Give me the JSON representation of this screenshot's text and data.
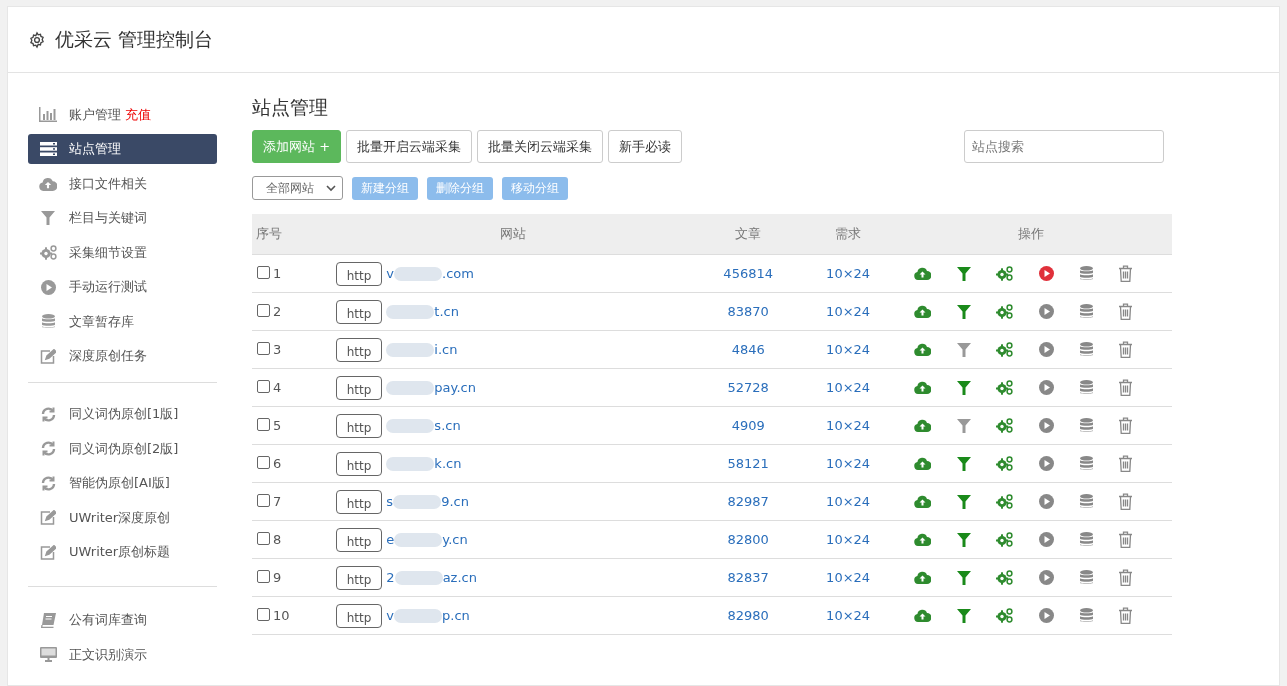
{
  "header": {
    "title": "优采云 管理控制台"
  },
  "sidebar": {
    "groups": [
      {
        "items": [
          {
            "label": "账户管理",
            "link": "充值",
            "selected": false
          },
          {
            "label": "站点管理",
            "selected": true
          },
          {
            "label": "接口文件相关",
            "selected": false
          },
          {
            "label": "栏目与关键词",
            "selected": false
          },
          {
            "label": "采集细节设置",
            "selected": false
          },
          {
            "label": "手动运行测试",
            "selected": false
          },
          {
            "label": "文章暂存库",
            "selected": false
          },
          {
            "label": "深度原创任务",
            "selected": false
          }
        ]
      },
      {
        "items": [
          {
            "label": "同义词伪原创[1版]",
            "selected": false
          },
          {
            "label": "同义词伪原创[2版]",
            "selected": false
          },
          {
            "label": "智能伪原创[AI版]",
            "selected": false
          },
          {
            "label": "UWriter深度原创",
            "selected": false
          },
          {
            "label": "UWriter原创标题",
            "selected": false
          }
        ]
      },
      {
        "items": [
          {
            "label": "公有词库查询",
            "selected": false
          },
          {
            "label": "正文识别演示",
            "selected": false
          }
        ]
      }
    ]
  },
  "main": {
    "title": "站点管理",
    "buttons": [
      {
        "label": "添加网站 +",
        "kind": "primary"
      },
      {
        "label": "批量开启云端采集",
        "kind": "default"
      },
      {
        "label": "批量关闭云端采集",
        "kind": "default"
      },
      {
        "label": "新手必读",
        "kind": "default"
      }
    ],
    "search": {
      "placeholder": "站点搜索"
    },
    "group_select": {
      "value": "全部网站"
    },
    "group_buttons": [
      "新建分组",
      "删除分组",
      "移动分组"
    ],
    "table": {
      "columns": [
        "序号",
        "网站",
        "文章",
        "需求",
        "操作"
      ],
      "rows": [
        {
          "index": "1",
          "checked": false,
          "protocol": "http",
          "site_prefix": "v",
          "site_suffix": ".com",
          "articles": "456814",
          "demand": "10×24",
          "filter_on": true,
          "running": true
        },
        {
          "index": "2",
          "checked": false,
          "protocol": "http",
          "site_suffix": "t.cn",
          "articles": "83870",
          "demand": "10×24",
          "filter_on": true,
          "running": false
        },
        {
          "index": "3",
          "checked": false,
          "protocol": "http",
          "site_suffix": "i.cn",
          "articles": "4846",
          "demand": "10×24",
          "filter_on": false,
          "running": false
        },
        {
          "index": "4",
          "checked": false,
          "protocol": "http",
          "site_suffix": "pay.cn",
          "articles": "52728",
          "demand": "10×24",
          "filter_on": true,
          "running": false
        },
        {
          "index": "5",
          "checked": false,
          "protocol": "http",
          "site_suffix": "s.cn",
          "articles": "4909",
          "demand": "10×24",
          "filter_on": false,
          "running": false
        },
        {
          "index": "6",
          "checked": false,
          "protocol": "http",
          "site_suffix": "k.cn",
          "articles": "58121",
          "demand": "10×24",
          "filter_on": true,
          "running": false
        },
        {
          "index": "7",
          "checked": false,
          "protocol": "http",
          "site_prefix": "s",
          "site_suffix": "9.cn",
          "articles": "82987",
          "demand": "10×24",
          "filter_on": true,
          "running": false
        },
        {
          "index": "8",
          "checked": false,
          "protocol": "http",
          "site_prefix": "e",
          "site_suffix": "y.cn",
          "articles": "82800",
          "demand": "10×24",
          "filter_on": true,
          "running": false
        },
        {
          "index": "9",
          "checked": false,
          "protocol": "http",
          "site_prefix": "2",
          "site_suffix": "az.cn",
          "articles": "82837",
          "demand": "10×24",
          "filter_on": true,
          "running": false
        },
        {
          "index": "10",
          "checked": false,
          "protocol": "http",
          "site_prefix": "v",
          "site_suffix": "p.cn",
          "articles": "82980",
          "demand": "10×24",
          "filter_on": true,
          "running": false
        }
      ]
    }
  }
}
